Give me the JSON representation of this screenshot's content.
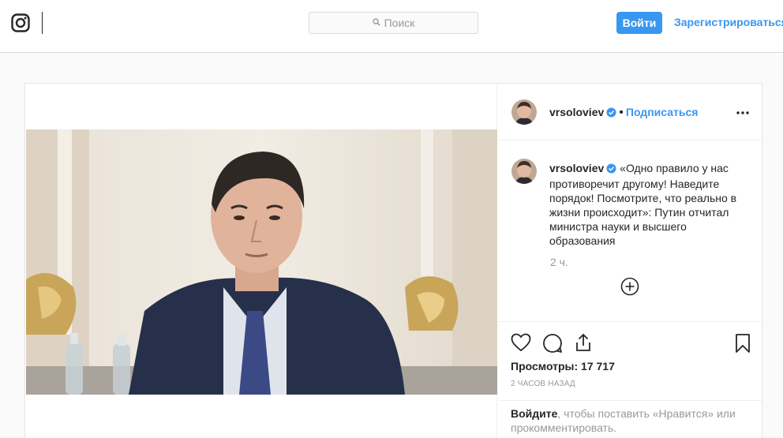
{
  "header": {
    "search_placeholder": "Поиск",
    "login_label": "Войти",
    "signup_label": "Зарегистрироваться"
  },
  "post": {
    "username": "vrsoloviev",
    "follow_label": "Подписаться",
    "dot": "•",
    "caption": "«Одно правило у нас противоречит другому! Наведите порядок! Посмотрите, что реально в жизни происходит»: Путин отчитал министра науки и высшего образования",
    "relative_time": "2 ч.",
    "views_text": "Просмотры: 17 717",
    "timestamp": "2 часов назад",
    "login_link": "Войдите",
    "login_rest": ", чтобы поставить «Нравится» или прокомментировать."
  },
  "icons": {
    "logo": "instagram-logo-icon",
    "search": "search-icon",
    "verified": "verified-badge-icon",
    "more": "more-options-icon",
    "add_comment": "plus-circle-icon",
    "like": "heart-icon",
    "comment": "comment-icon",
    "share": "share-icon",
    "save": "bookmark-icon"
  },
  "colors": {
    "accent": "#3897f0",
    "text": "#262626",
    "muted": "#999999",
    "border": "#dbdbdb",
    "background": "#fafafa"
  }
}
